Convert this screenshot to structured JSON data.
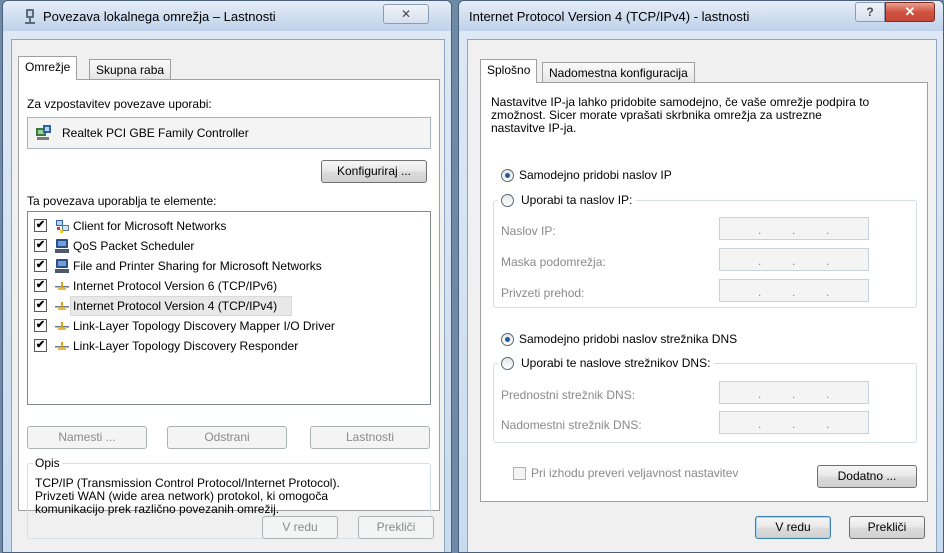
{
  "left_window": {
    "title": "Povezava lokalnega omrežja – Lastnosti",
    "close_label": "✕",
    "tabs": [
      "Omrežje",
      "Skupna raba"
    ],
    "connect_using_label": "Za vzpostavitev povezave uporabi:",
    "adapter_name": "Realtek PCI GBE Family Controller",
    "configure_button": "Konfiguriraj ...",
    "items_label": "Ta povezava uporablja te elemente:",
    "items": [
      {
        "label": "Client for Microsoft Networks",
        "checked": true,
        "icon": "client-network-icon"
      },
      {
        "label": "QoS Packet Scheduler",
        "checked": true,
        "icon": "service-icon"
      },
      {
        "label": "File and Printer Sharing for Microsoft Networks",
        "checked": true,
        "icon": "service-icon"
      },
      {
        "label": "Internet Protocol Version 6 (TCP/IPv6)",
        "checked": true,
        "icon": "protocol-icon"
      },
      {
        "label": "Internet Protocol Version 4 (TCP/IPv4)",
        "checked": true,
        "icon": "protocol-icon"
      },
      {
        "label": "Link-Layer Topology Discovery Mapper I/O Driver",
        "checked": true,
        "icon": "protocol-icon"
      },
      {
        "label": "Link-Layer Topology Discovery Responder",
        "checked": true,
        "icon": "protocol-icon"
      }
    ],
    "install_button": "Namesti ...",
    "uninstall_button": "Odstrani",
    "properties_button": "Lastnosti",
    "description_label": "Opis",
    "description_lines": [
      "TCP/IP (Transmission Control Protocol/Internet Protocol).",
      "Privzeti WAN (wide area network) protokol, ki omogoča",
      "komunikacijo prek različno povezanih omrežij."
    ],
    "ok_button": "V redu",
    "cancel_button": "Prekliči"
  },
  "right_window": {
    "title": "Internet Protocol Version 4 (TCP/IPv4) - lastnosti",
    "help_label": "?",
    "close_label": "✕",
    "tabs": [
      "Splošno",
      "Nadomestna konfiguracija"
    ],
    "intro_lines": [
      "Nastavitve IP-ja lahko pridobite samodejno, če vaše omrežje podpira to",
      "zmožnost. Sicer morate vprašati skrbnika omrežja za ustrezne",
      "nastavitve IP-ja."
    ],
    "auto_ip_label": "Samodejno pridobi naslov IP",
    "manual_ip_label": "Uporabi ta naslov IP:",
    "ip_address_label": "Naslov IP:",
    "subnet_label": "Maska podomrežja:",
    "gateway_label": "Privzeti prehod:",
    "auto_dns_label": "Samodejno pridobi naslov strežnika DNS",
    "manual_dns_label": "Uporabi te naslove strežnikov DNS:",
    "preferred_dns_label": "Prednostni strežnik DNS:",
    "alternate_dns_label": "Nadomestni strežnik DNS:",
    "ip_dot": ".",
    "validate_label": "Pri izhodu preveri veljavnost nastavitev",
    "advanced_button": "Dodatno ...",
    "ok_button": "V redu",
    "cancel_button": "Prekliči",
    "ip_mode": "auto",
    "dns_mode": "auto"
  },
  "colors": {
    "close_button": "#c7453a",
    "selected_item": "#e8e8e8"
  }
}
